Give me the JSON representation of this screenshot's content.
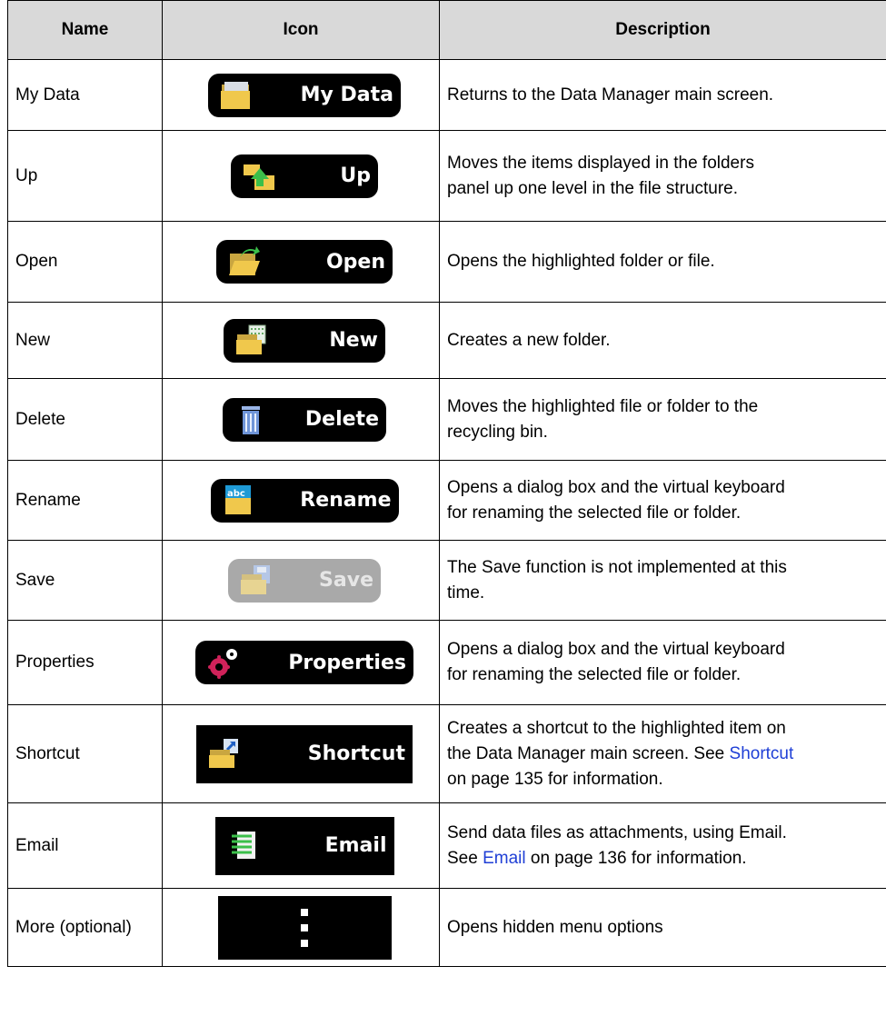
{
  "table": {
    "headers": [
      "Name",
      "Icon",
      "Description"
    ],
    "rows": [
      {
        "name": "My Data",
        "icon_label": "My Data",
        "icon": "folder-icon",
        "desc": [
          "Returns to the Data Manager main screen."
        ]
      },
      {
        "name": "Up",
        "icon_label": "Up",
        "icon": "folder-up-arrow-icon",
        "desc": [
          "Moves the items displayed in the folders",
          "panel up one level in the file structure."
        ]
      },
      {
        "name": "Open",
        "icon_label": "Open",
        "icon": "open-folder-icon",
        "desc": [
          "Opens the highlighted folder or file."
        ]
      },
      {
        "name": "New",
        "icon_label": "New",
        "icon": "new-folder-icon",
        "desc": [
          "Creates a new folder."
        ]
      },
      {
        "name": "Delete",
        "icon_label": "Delete",
        "icon": "trash-icon",
        "desc": [
          "Moves the highlighted file or folder to the",
          "recycling bin."
        ]
      },
      {
        "name": "Rename",
        "icon_label": "Rename",
        "icon": "rename-folder-icon",
        "desc": [
          "Opens a dialog box and the virtual keyboard",
          "for renaming the selected file or folder."
        ]
      },
      {
        "name": "Save",
        "icon_label": "Save",
        "icon": "save-folder-icon",
        "desc": [
          "The Save function is not implemented at this",
          "time."
        ]
      },
      {
        "name": "Properties",
        "icon_label": "Properties",
        "icon": "gears-icon",
        "desc": [
          "Opens a dialog box and the virtual keyboard",
          "for renaming the selected file or folder."
        ]
      },
      {
        "name": "Shortcut",
        "icon_label": "Shortcut",
        "icon": "shortcut-folder-icon",
        "desc": {
          "line1": "Creates a shortcut to the highlighted item on",
          "line2_pre": "the Data Manager main screen. See ",
          "link": "Shortcut",
          "line3": "on page 135 for information."
        }
      },
      {
        "name": "Email",
        "icon_label": "Email",
        "icon": "document-icon",
        "desc": {
          "line1": "Send data files as attachments, using Email.",
          "line2_pre": "See ",
          "link": "Email",
          "line2_post": " on page 136 for information."
        }
      },
      {
        "name": "More (optional)",
        "icon_label": "",
        "icon": "vertical-dots-icon",
        "desc": [
          "Opens hidden menu options"
        ]
      }
    ]
  },
  "colors": {
    "link": "#1f3fd6",
    "header_bg": "#d9d9d9",
    "button_bg": "#000000",
    "disabled_bg": "#a9a9a9"
  }
}
